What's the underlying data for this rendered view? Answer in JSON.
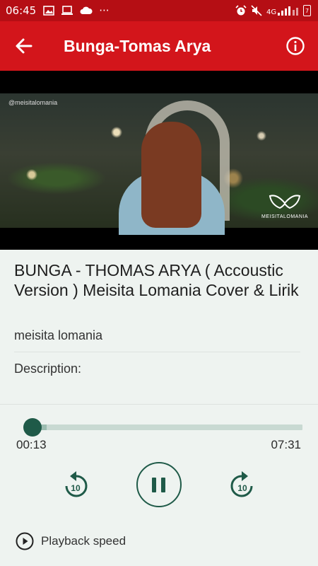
{
  "status_bar": {
    "time": "06:45",
    "icons": [
      "image-icon",
      "laptop-icon",
      "cloud-icon",
      "more-dots-icon",
      "alarm-icon",
      "mute-icon",
      "signal-icon",
      "battery-icon"
    ],
    "more": "···",
    "battery": "7"
  },
  "app_bar": {
    "title": "Bunga-Tomas Arya",
    "color": "#d3151b"
  },
  "video": {
    "watermark": "@meisitalomania",
    "logo_text": "MEISITALOMANIA"
  },
  "details": {
    "title": "BUNGA - THOMAS ARYA ( Accoustic Version ) Meisita Lomania Cover & Lirik",
    "channel": "meisita lomania",
    "description_label": "Description:"
  },
  "player": {
    "current_time": "00:13",
    "total_time": "07:31",
    "progress": 0.029,
    "buffered": 0.08,
    "rewind_seconds": "10",
    "forward_seconds": "10",
    "accent": "#1f5a48"
  },
  "playback_speed": {
    "label": "Playback speed"
  }
}
